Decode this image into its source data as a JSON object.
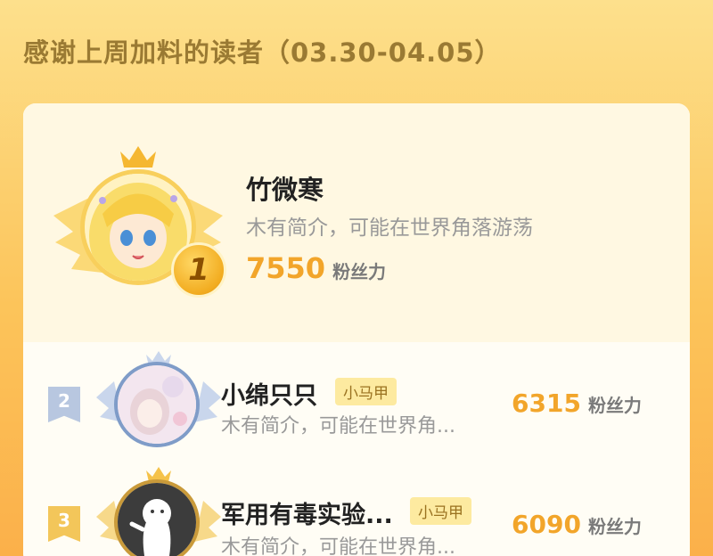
{
  "header": {
    "title": "感谢上周加料的读者（03.30-04.05）"
  },
  "fans_unit": "粉丝力",
  "top": {
    "rank": "1",
    "name": "竹微寒",
    "bio": "木有简介，可能在世界角落游荡",
    "score": "7550"
  },
  "rows": [
    {
      "rank": "2",
      "name": "小绵只只",
      "tag": "小马甲",
      "bio": "木有简介，可能在世界角...",
      "score": "6315"
    },
    {
      "rank": "3",
      "name": "军用有毒实验...",
      "tag": "小马甲",
      "bio": "木有简介，可能在世界角...",
      "score": "6090"
    }
  ],
  "colors": {
    "accent": "#f2a52a",
    "title": "#9a7a33",
    "gold": "#f5b731",
    "silver": "#b8c7e0"
  }
}
